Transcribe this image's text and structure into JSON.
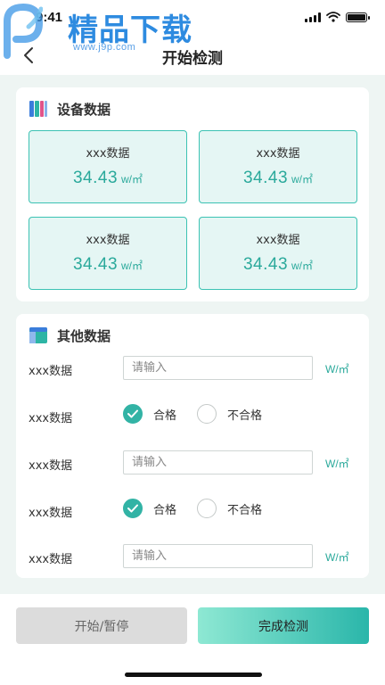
{
  "status_bar": {
    "time": "9:41"
  },
  "watermark": {
    "title": "精品下载",
    "url": "www.j9p.com"
  },
  "nav": {
    "title": "开始检测"
  },
  "device_section": {
    "title": "设备数据",
    "tiles": [
      {
        "name": "xxx数据",
        "value": "34.43",
        "unit": "w/㎡"
      },
      {
        "name": "xxx数据",
        "value": "34.43",
        "unit": "w/㎡"
      },
      {
        "name": "xxx数据",
        "value": "34.43",
        "unit": "w/㎡"
      },
      {
        "name": "xxx数据",
        "value": "34.43",
        "unit": "w/㎡"
      }
    ]
  },
  "other_section": {
    "title": "其他数据",
    "rows": [
      {
        "label": "xxx数据",
        "placeholder": "请输入",
        "unit": "W/㎡"
      },
      {
        "label": "xxx数据",
        "pass_label": "合格",
        "fail_label": "不合格",
        "selected": "合格"
      },
      {
        "label": "xxx数据",
        "placeholder": "请输入",
        "unit": "W/㎡"
      },
      {
        "label": "xxx数据",
        "pass_label": "合格",
        "fail_label": "不合格",
        "selected": "合格"
      },
      {
        "label": "xxx数据",
        "placeholder": "请输入",
        "unit": "W/㎡"
      }
    ]
  },
  "actions": {
    "start_pause": "开始/暂停",
    "finish": "完成检测"
  },
  "colors": {
    "accent": "#32b3a5",
    "tile_bg": "#e5f6f4",
    "page_bg": "#eef5f3"
  }
}
